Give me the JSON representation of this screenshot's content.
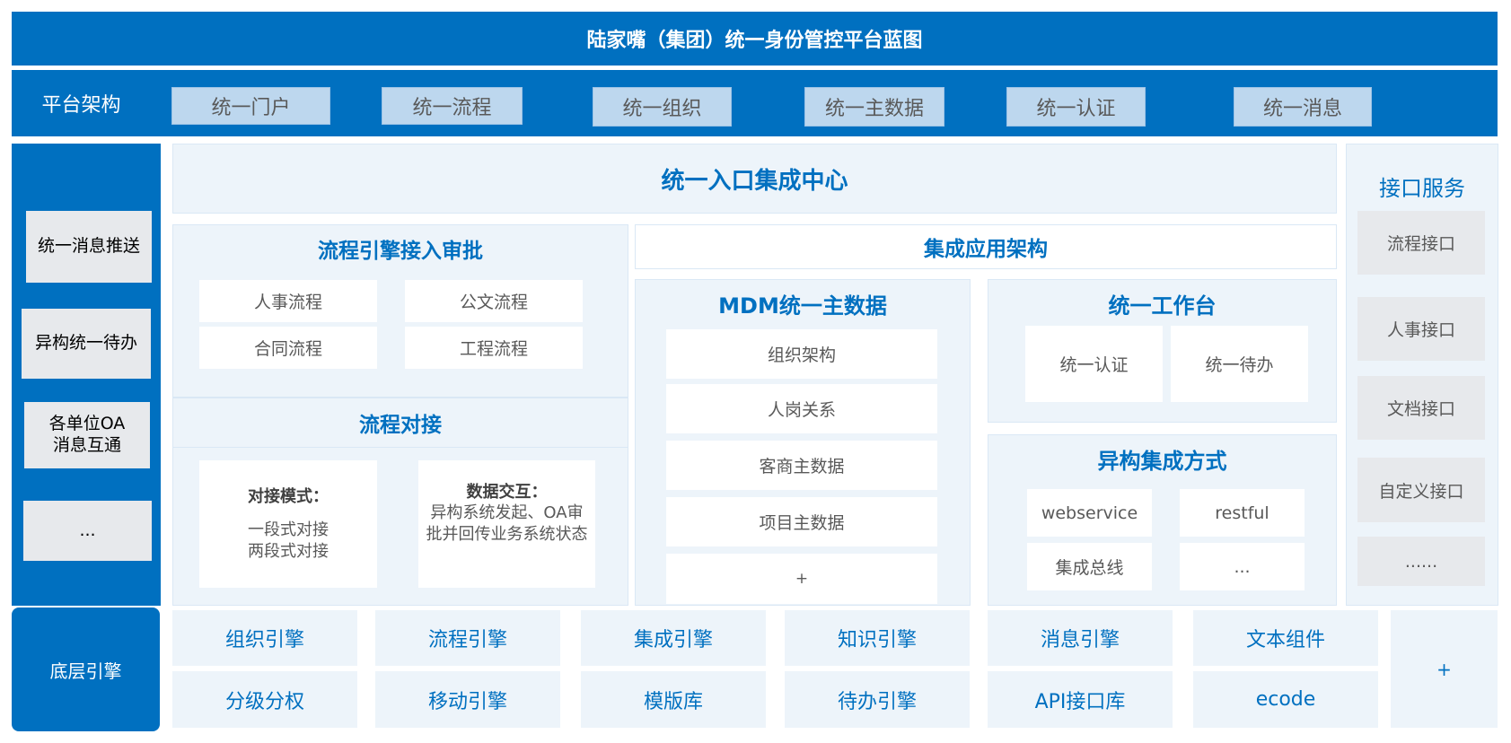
{
  "title": "陆家嘴（集团）统一身份管控平台蓝图",
  "platform": {
    "label": "平台架构",
    "items": [
      "统一门户",
      "统一流程",
      "统一组织",
      "统一主数据",
      "统一认证",
      "统一消息"
    ]
  },
  "left_items": [
    "统一消息推送",
    "异构统一待办",
    "各单位OA\n消息互通",
    "..."
  ],
  "center": {
    "title": "统一入口集成中心",
    "approval": {
      "title": "流程引擎接入审批",
      "items": [
        "人事流程",
        "公文流程",
        "合同流程",
        "工程流程"
      ]
    },
    "docking": {
      "title": "流程对接",
      "mode_title": "对接模式：",
      "mode_lines": [
        "一段式对接",
        "两段式对接"
      ],
      "exchange_title": "数据交互：",
      "exchange_text": "异构系统发起、OA审批并回传业务系统状态"
    },
    "integration_title": "集成应用架构",
    "mdm": {
      "title": "MDM统一主数据",
      "items": [
        "组织架构",
        "人岗关系",
        "客商主数据",
        "项目主数据",
        "+"
      ]
    },
    "workbench": {
      "title": "统一工作台",
      "items": [
        "统一认证",
        "统一待办"
      ]
    },
    "hetero": {
      "title": "异构集成方式",
      "items": [
        "webservice",
        "restful",
        "集成总线",
        "..."
      ]
    }
  },
  "interface": {
    "title": "接口服务",
    "items": [
      "流程接口",
      "人事接口",
      "文档接口",
      "自定义接口",
      "......"
    ]
  },
  "bottom": {
    "label": "底层引擎",
    "row1": [
      "组织引擎",
      "流程引擎",
      "集成引擎",
      "知识引擎",
      "消息引擎",
      "文本组件"
    ],
    "row2": [
      "分级分权",
      "移动引擎",
      "模版库",
      "待办引擎",
      "API接口库",
      "ecode"
    ],
    "plus": "+"
  },
  "colors": {
    "primary": "#0070c0",
    "light_blue": "#bdd7ee",
    "panel": "#edf4fa",
    "tile_gray": "#e7e9ec"
  }
}
